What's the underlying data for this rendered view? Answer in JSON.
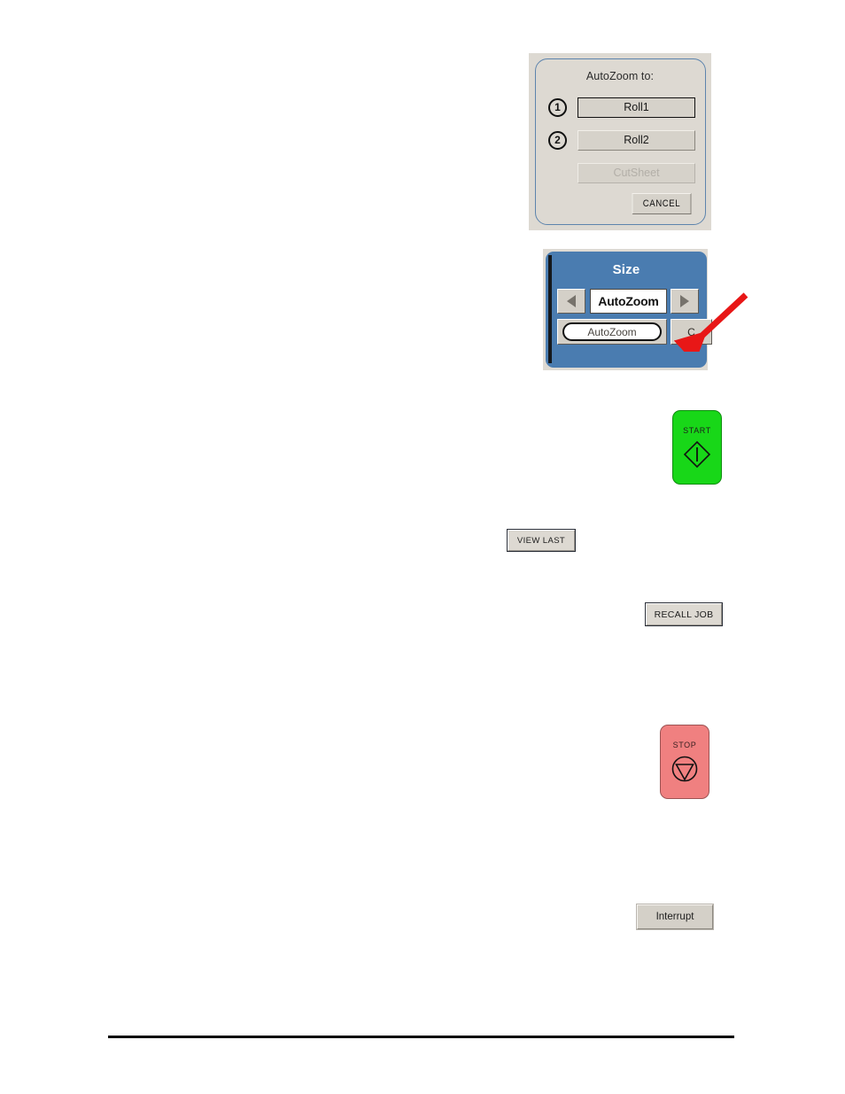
{
  "page": {
    "background_color": "#ffffff",
    "footer_rule_color": "#000000"
  },
  "autozoom_dialog": {
    "title": "AutoZoom to:",
    "background_color": "#ddd9d2",
    "border_color": "#5d84ad",
    "options": [
      {
        "number": "1",
        "label": "Roll1",
        "state": "focused"
      },
      {
        "number": "2",
        "label": "Roll2",
        "state": "enabled"
      },
      {
        "number": "",
        "label": "CutSheet",
        "state": "disabled"
      }
    ],
    "cancel_label": "CANCEL"
  },
  "size_panel": {
    "title": "Size",
    "panel_color": "#4a7cb0",
    "surround_color": "#dedad3",
    "prev_icon": "triangle-left-icon",
    "next_icon": "triangle-right-icon",
    "value": "AutoZoom",
    "pill_label": "AutoZoom",
    "partial_button_label": "C",
    "annotation": {
      "type": "arrow",
      "color": "#e81717",
      "points_to": "partial-button"
    }
  },
  "controls": {
    "start": {
      "label": "START",
      "color": "#18d718",
      "icon": "diamond-play-icon"
    },
    "stop": {
      "label": "STOP",
      "color": "#f08080",
      "icon": "circle-triangle-down-icon"
    },
    "view_last": {
      "label": "VIEW LAST"
    },
    "recall_job": {
      "label": "RECALL JOB"
    },
    "interrupt": {
      "label": "Interrupt"
    }
  }
}
